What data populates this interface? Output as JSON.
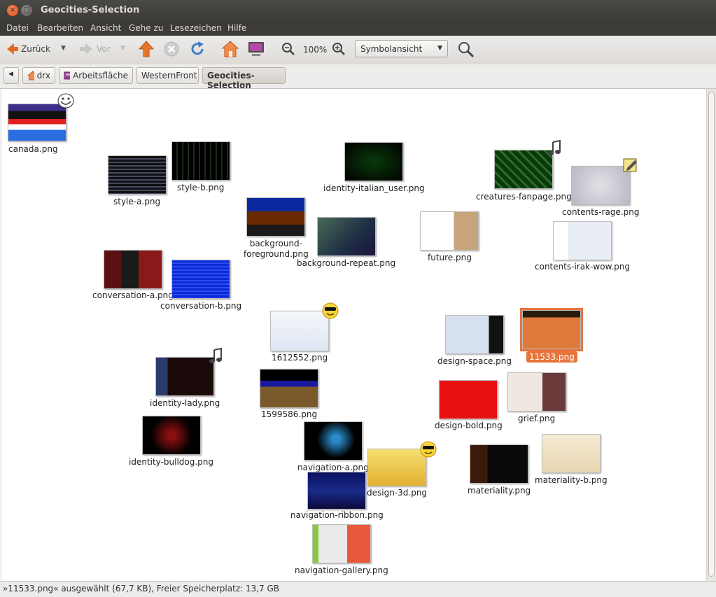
{
  "window": {
    "title": "Geocities-Selection"
  },
  "menu": [
    "Datei",
    "Bearbeiten",
    "Ansicht",
    "Gehe zu",
    "Lesezeichen",
    "Hilfe"
  ],
  "toolbar": {
    "back": "Zurück",
    "forward": "Vor",
    "zoom": "100%",
    "view_mode": "Symbolansicht"
  },
  "path": [
    "drx",
    "Arbeitsfläche",
    "WesternFront",
    "Geocities-Selection"
  ],
  "files": [
    {
      "name": "canada.png",
      "emblem": "troll-face-icon"
    },
    {
      "name": "style-a.png"
    },
    {
      "name": "style-b.png"
    },
    {
      "name": "identity-italian_user.png"
    },
    {
      "name": "creatures-fanpage.png",
      "emblem": "music-note-icon"
    },
    {
      "name": "contents-rage.png",
      "emblem": "note-edit-icon"
    },
    {
      "name": "background-foreground.png"
    },
    {
      "name": "background-repeat.png"
    },
    {
      "name": "future.png"
    },
    {
      "name": "contents-irak-wow.png"
    },
    {
      "name": "conversation-a.png"
    },
    {
      "name": "conversation-b.png"
    },
    {
      "name": "1612552.png",
      "emblem": "cool-face-icon"
    },
    {
      "name": "design-space.png"
    },
    {
      "name": "11533.png",
      "selected": true
    },
    {
      "name": "identity-lady.png",
      "emblem": "music-note-icon"
    },
    {
      "name": "1599586.png"
    },
    {
      "name": "design-bold.png"
    },
    {
      "name": "grief.png"
    },
    {
      "name": "identity-bulldog.png"
    },
    {
      "name": "navigation-a.png"
    },
    {
      "name": "design-3d.png",
      "emblem": "cool-face-icon"
    },
    {
      "name": "materiality.png"
    },
    {
      "name": "materiality-b.png"
    },
    {
      "name": "navigation-ribbon.png"
    },
    {
      "name": "navigation-gallery.png"
    }
  ],
  "status": "»11533.png« ausgewählt (67,7 KB), Freier Speicherplatz: 13,7 GB",
  "colors": {
    "accent": "#e8743b",
    "titlebar": "#3c3b37"
  }
}
